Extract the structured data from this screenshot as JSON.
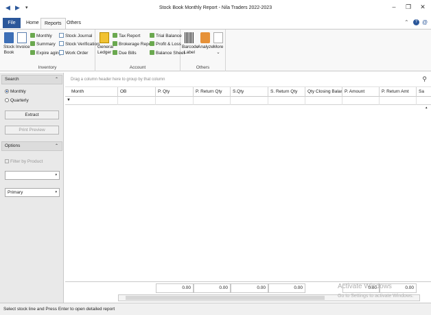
{
  "titlebar": {
    "title": "Stock Book Monthly Report - Nila Traders 2022-2023",
    "back_glyph": "◀",
    "forward_glyph": "▶",
    "qa_glyph": "▾",
    "minimize": "–",
    "restore": "❐",
    "close": "✕"
  },
  "tabs": {
    "file": "File",
    "items": [
      "Home",
      "Reports",
      "Others"
    ],
    "active": "Reports",
    "right_icons": [
      "⌃",
      "?",
      "@"
    ]
  },
  "ribbon": {
    "inventory": {
      "label": "Inventory",
      "stock_book": [
        "Stock",
        "Book"
      ],
      "invoice": "Invoice",
      "monthly": "Monthly",
      "summary": "Summary",
      "expire_aging": "Expire aging",
      "stock_journal": "Stock Journal",
      "stock_verification": "Stock Verification",
      "work_order": "Work Order"
    },
    "account": {
      "label": "Account",
      "general_ledger": [
        "General",
        "Ledger"
      ],
      "tax_report": "Tax Report",
      "brokerage_report": "Brokerage Report",
      "due_bills": "Due Bills",
      "trial_balance": "Trial Balance",
      "profit_loss": "Profit & Loss",
      "balance_sheet": "Balance Sheet"
    },
    "others": {
      "label": "Others",
      "barcode_label": [
        "Barcode",
        "Label"
      ],
      "analyze": "Analyze",
      "more": "More",
      "more_arrow": "⌄"
    }
  },
  "leftpanel": {
    "search_header": "Search",
    "monthly": "Monthly",
    "quarterly": "Quarterly",
    "extract": "Extract",
    "print_preview": "Print Preview",
    "options_header": "Options",
    "filter_by_product": "Filter by Product",
    "combo1_value": "",
    "combo2_value": "Primary",
    "chevron": "⌃",
    "combo_arrow": "▾"
  },
  "grid": {
    "group_hint": "Drag a column header here to group by that column",
    "search_glyph": "⚲",
    "filter_glyph": "▼",
    "columns": [
      "Month",
      "OB",
      "P. Qty",
      "P. Return Qty",
      "S.Qty",
      "S. Return Qty",
      "Qty Closing Balance",
      "P. Amount",
      "P. Return Amt",
      "Sa"
    ],
    "footer_totals": [
      "0.00",
      "0.00",
      "0.00",
      "0.00",
      "0.00",
      "0.00"
    ]
  },
  "watermark": {
    "line1": "Activate Windows",
    "line2": "Go to Settings to activate Windows."
  },
  "status": "Select stock line and Press Enter to open detailed report"
}
